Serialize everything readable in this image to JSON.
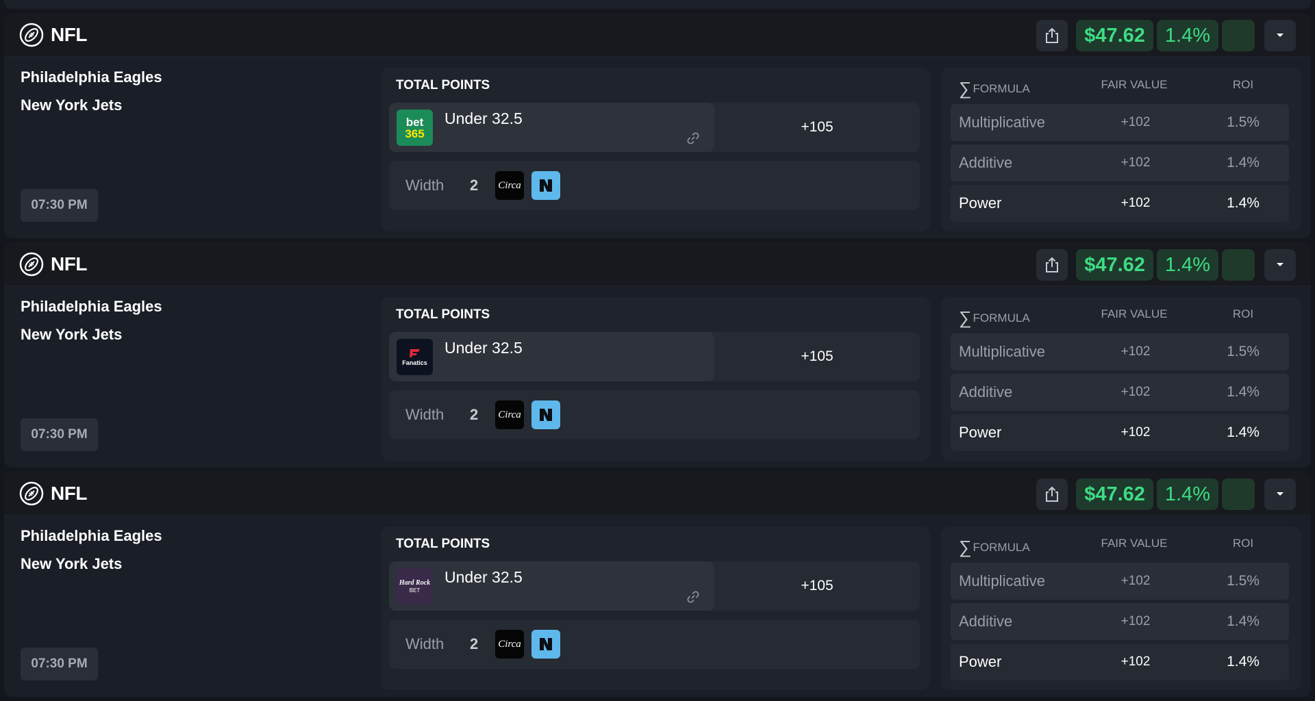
{
  "cards": [
    {
      "league": "NFL",
      "money": "$47.62",
      "pct": "1.4%",
      "team1": "Philadelphia Eagles",
      "team2": "New York Jets",
      "time": "07:30 PM",
      "market": "TOTAL POINTS",
      "book_icon": "bet365-logo",
      "book_text_top": "bet",
      "book_text_bottom": "365",
      "line": "Under 32.5",
      "odds": "+105",
      "width_label": "Width",
      "width_value": "2",
      "formula_head": "FORMULA",
      "fair_head": "FAIR VALUE",
      "roi_head": "ROI",
      "formulas": [
        {
          "name": "Multiplicative",
          "fair": "+102",
          "roi": "1.5%"
        },
        {
          "name": "Additive",
          "fair": "+102",
          "roi": "1.4%"
        },
        {
          "name": "Power",
          "fair": "+102",
          "roi": "1.4%"
        }
      ]
    },
    {
      "league": "NFL",
      "money": "$47.62",
      "pct": "1.4%",
      "team1": "Philadelphia Eagles",
      "team2": "New York Jets",
      "time": "07:30 PM",
      "market": "TOTAL POINTS",
      "book_icon": "fanatics-logo",
      "book_text_top": "Fanatics",
      "book_text_bottom": "",
      "line": "Under 32.5",
      "odds": "+105",
      "width_label": "Width",
      "width_value": "2",
      "formula_head": "FORMULA",
      "fair_head": "FAIR VALUE",
      "roi_head": "ROI",
      "formulas": [
        {
          "name": "Multiplicative",
          "fair": "+102",
          "roi": "1.5%"
        },
        {
          "name": "Additive",
          "fair": "+102",
          "roi": "1.4%"
        },
        {
          "name": "Power",
          "fair": "+102",
          "roi": "1.4%"
        }
      ]
    },
    {
      "league": "NFL",
      "money": "$47.62",
      "pct": "1.4%",
      "team1": "Philadelphia Eagles",
      "team2": "New York Jets",
      "time": "07:30 PM",
      "market": "TOTAL POINTS",
      "book_icon": "hardrock-logo",
      "book_text_top": "Hard Rock",
      "book_text_bottom": "BET",
      "line": "Under 32.5",
      "odds": "+105",
      "width_label": "Width",
      "width_value": "2",
      "formula_head": "FORMULA",
      "fair_head": "FAIR VALUE",
      "roi_head": "ROI",
      "formulas": [
        {
          "name": "Multiplicative",
          "fair": "+102",
          "roi": "1.5%"
        },
        {
          "name": "Additive",
          "fair": "+102",
          "roi": "1.4%"
        },
        {
          "name": "Power",
          "fair": "+102",
          "roi": "1.4%"
        }
      ]
    }
  ],
  "icons": {
    "league": "football-icon",
    "share": "share-icon",
    "dropdown": "caret-down-icon",
    "link": "link-icon",
    "circa": "circa-sports-logo",
    "n": "novig-logo"
  },
  "circa_text": "Circa",
  "colors": {
    "accent_green": "#3ddc84",
    "green_bg": "#1e3a2c",
    "bet365": "#1b8c57",
    "n_blue": "#5eb8ec"
  }
}
